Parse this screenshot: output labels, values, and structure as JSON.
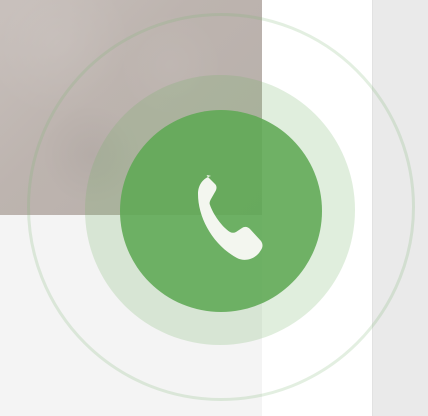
{
  "background": {
    "left_color": "#f4f4f4",
    "center_color": "#ffffff",
    "right_color": "#eaeaea"
  },
  "photo_panel": {
    "color": "#bfb6b1"
  },
  "call_widget": {
    "primary_color": "#5fa854",
    "mid_ring_color": "#71b165",
    "outer_ring_color": "#81b878",
    "icon_color": "#f3f6ef",
    "icon": "phone-icon"
  }
}
